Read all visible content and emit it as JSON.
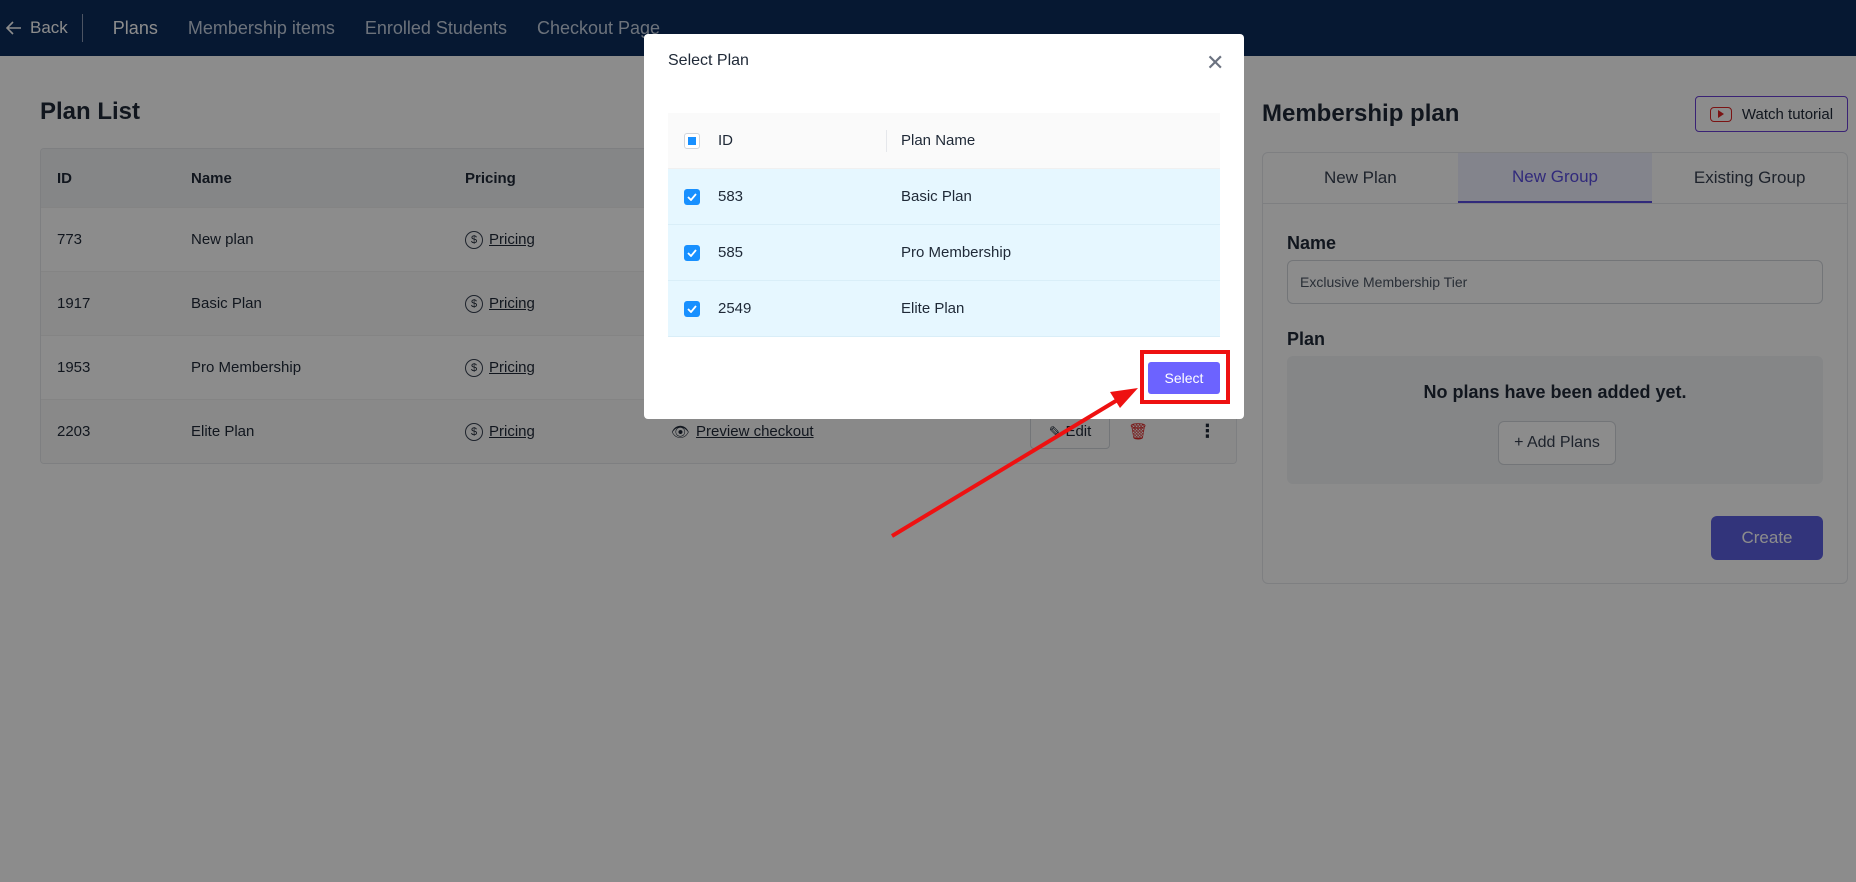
{
  "nav": {
    "back_label": "Back",
    "tabs": [
      "Plans",
      "Membership items",
      "Enrolled Students",
      "Checkout Page"
    ],
    "active_tab": "Plans"
  },
  "plan_list": {
    "title": "Plan List",
    "columns": [
      "ID",
      "Name",
      "Pricing"
    ],
    "rows": [
      {
        "id": "773",
        "name": "New plan",
        "pricing": "Pricing"
      },
      {
        "id": "1917",
        "name": "Basic Plan",
        "pricing": "Pricing"
      },
      {
        "id": "1953",
        "name": "Pro Membership",
        "pricing": "Pricing"
      },
      {
        "id": "2203",
        "name": "Elite Plan",
        "pricing": "Pricing",
        "preview": "Preview checkout",
        "edit": "Edit"
      }
    ]
  },
  "membership_panel": {
    "title": "Membership plan",
    "tutorial_label": "Watch tutorial",
    "tabs": [
      "New Plan",
      "New Group",
      "Existing Group"
    ],
    "active_tab": "New Group",
    "name_label": "Name",
    "name_value": "Exclusive Membership Tier",
    "plan_label": "Plan",
    "empty_text": "No plans have been added yet.",
    "add_plans_label": "+ Add Plans",
    "create_label": "Create"
  },
  "modal": {
    "title": "Select Plan",
    "columns": [
      "ID",
      "Plan Name"
    ],
    "rows": [
      {
        "id": "583",
        "name": "Basic Plan",
        "checked": true
      },
      {
        "id": "585",
        "name": "Pro Membership",
        "checked": true
      },
      {
        "id": "2549",
        "name": "Elite Plan",
        "checked": true
      }
    ],
    "select_label": "Select"
  },
  "colors": {
    "nav_bg": "#0c2d5c",
    "accent": "#5b5fe0",
    "checkbox": "#1890ff",
    "annotation": "#ee1111"
  }
}
